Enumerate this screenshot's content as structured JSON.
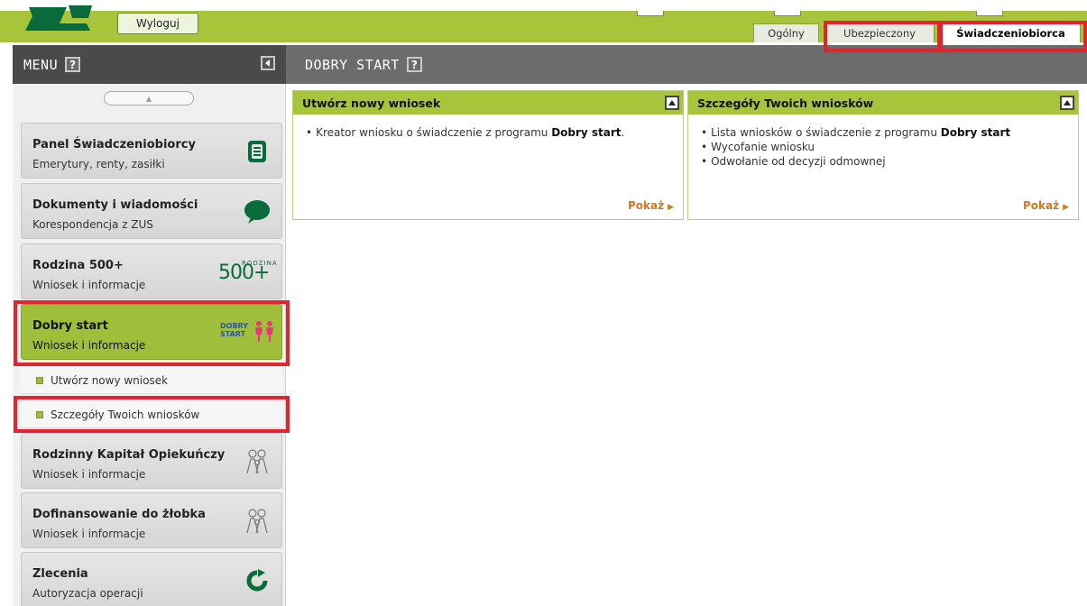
{
  "topbar": {
    "logout_label": "Wyloguj",
    "tabs": [
      {
        "label": "Ogólny"
      },
      {
        "label": "Ubezpieczony"
      },
      {
        "label": "Świadczeniobiorca"
      }
    ]
  },
  "sidebar": {
    "title": "MENU",
    "help": "?",
    "scroll_up": "▲",
    "items": [
      {
        "title": "Panel Świadczeniobiorcy",
        "subtitle": "Emerytury, renty, zasiłki",
        "icon": "id-card-icon"
      },
      {
        "title": "Dokumenty i wiadomości",
        "subtitle": "Korespondencja z ZUS",
        "icon": "speech-bubble-icon"
      },
      {
        "title": "Rodzina 500+",
        "subtitle": "Wniosek i informacje",
        "icon": "rodzina-500-logo"
      },
      {
        "title": "Dobry start",
        "subtitle": "Wniosek i informacje",
        "icon": "dobry-start-logo"
      },
      {
        "title": "Rodzinny Kapitał Opiekuńczy",
        "subtitle": "Wniosek i informacje",
        "icon": "family-icon"
      },
      {
        "title": "Dofinansowanie do żłobka",
        "subtitle": "Wniosek i informacje",
        "icon": "family-icon"
      },
      {
        "title": "Zlecenia",
        "subtitle": "Autoryzacja operacji",
        "icon": "refresh-icon"
      }
    ],
    "subitems": [
      {
        "label": "Utwórz nowy wniosek"
      },
      {
        "label": "Szczegóły Twoich wniosków"
      }
    ],
    "logo_text": {
      "rodzina": "RODZINA",
      "r500": "500+",
      "dobry": "DOBRY",
      "start": "START"
    }
  },
  "main": {
    "title": "DOBRY START",
    "help": "?",
    "panels": [
      {
        "title": "Utwórz nowy wniosek",
        "lines": [
          {
            "text": "Kreator wniosku o świadczenie z programu ",
            "bold": "Dobry start",
            "suffix": "."
          }
        ],
        "link": "Pokaż"
      },
      {
        "title": "Szczegóły Twoich wniosków",
        "lines": [
          {
            "text": "Lista wniosków o świadczenie z programu ",
            "bold": "Dobry start",
            "suffix": ""
          },
          {
            "text": "Wycofanie wniosku",
            "bold": "",
            "suffix": ""
          },
          {
            "text": "Odwołanie od decyzji odmownej",
            "bold": "",
            "suffix": ""
          }
        ],
        "link": "Pokaż"
      }
    ]
  },
  "colors": {
    "accent_green": "#a7c43a",
    "highlight_red": "#e0252f",
    "link_orange": "#d1791b"
  }
}
